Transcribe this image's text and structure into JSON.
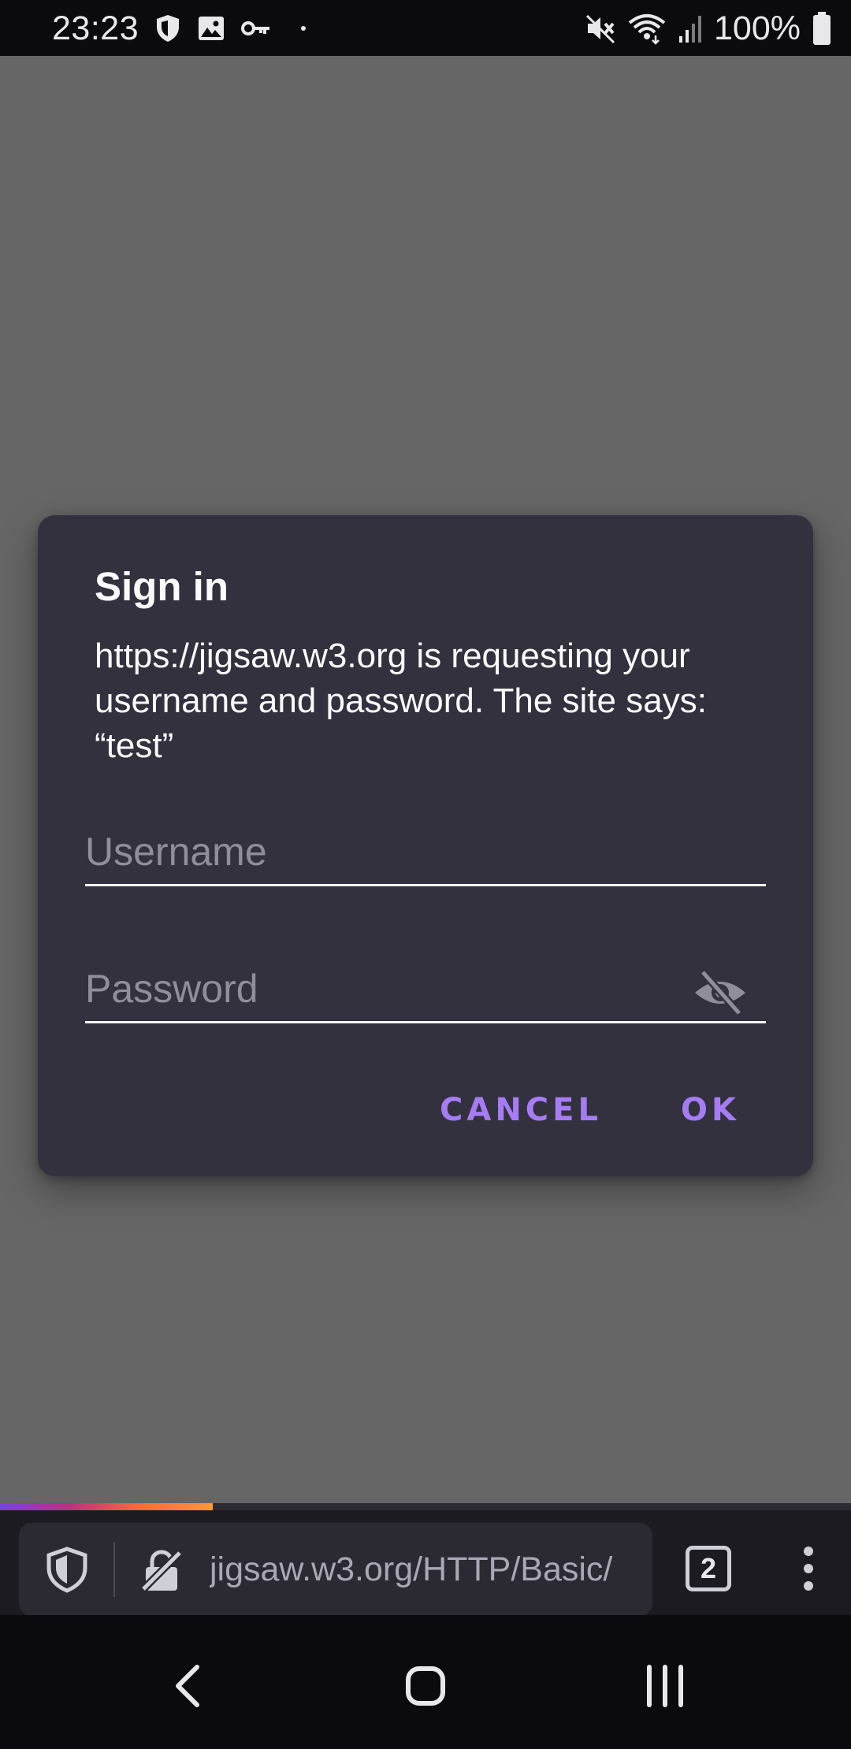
{
  "status_bar": {
    "time": "23:23",
    "battery_text": "100%",
    "icons_left": [
      "shield-icon",
      "image-icon",
      "key-icon",
      "dot-icon"
    ],
    "icons_right": [
      "mute-icon",
      "wifi-icon",
      "signal-icon",
      "battery-icon"
    ]
  },
  "dialog": {
    "title": "Sign in",
    "message": "https://jigsaw.w3.org is requesting your username and password. The site says: “test”",
    "username": {
      "value": "",
      "placeholder": "Username"
    },
    "password": {
      "value": "",
      "placeholder": "Password",
      "toggle_icon": "eye-off-icon"
    },
    "cancel_label": "CANCEL",
    "ok_label": "OK",
    "accent_color": "#a67cf4"
  },
  "progress": {
    "fraction": 0.25
  },
  "toolbar": {
    "url": "jigsaw.w3.org/HTTP/Basic/",
    "tabs_count": "2",
    "shield_icon": "shield-icon",
    "site_icon": "insecure-lock-icon",
    "menu_icon": "more-vertical-icon"
  },
  "nav_bar": {
    "buttons": [
      "back-icon",
      "home-icon",
      "recents-icon"
    ]
  }
}
